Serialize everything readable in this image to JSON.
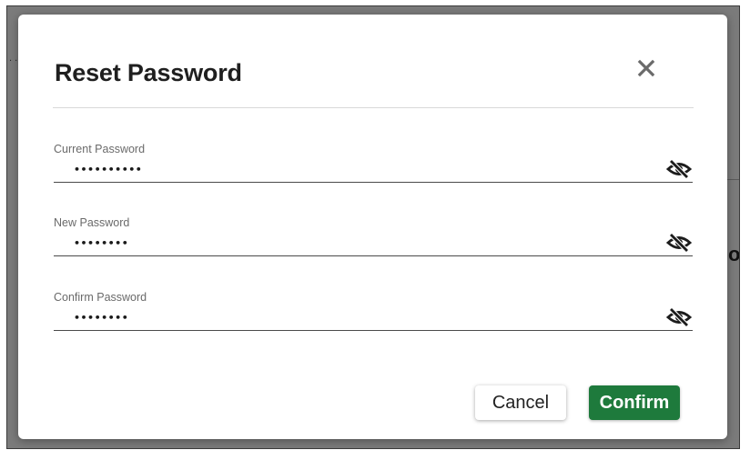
{
  "dialog": {
    "title": "Reset Password",
    "close_icon": "close-icon"
  },
  "fields": [
    {
      "label": "Current Password",
      "value": "••••••••••",
      "type": "password",
      "toggle_icon": "eye-off-icon"
    },
    {
      "label": "New Password",
      "value": "••••••••",
      "type": "password",
      "toggle_icon": "eye-off-icon"
    },
    {
      "label": "Confirm Password",
      "value": "••••••••",
      "type": "password",
      "toggle_icon": "eye-off-icon"
    }
  ],
  "actions": {
    "cancel_label": "Cancel",
    "confirm_label": "Confirm"
  },
  "background": {
    "partial_text": "o",
    "dots": ". ."
  },
  "colors": {
    "confirm_bg": "#1e7a3c",
    "overlay": "#7b7b7b"
  }
}
